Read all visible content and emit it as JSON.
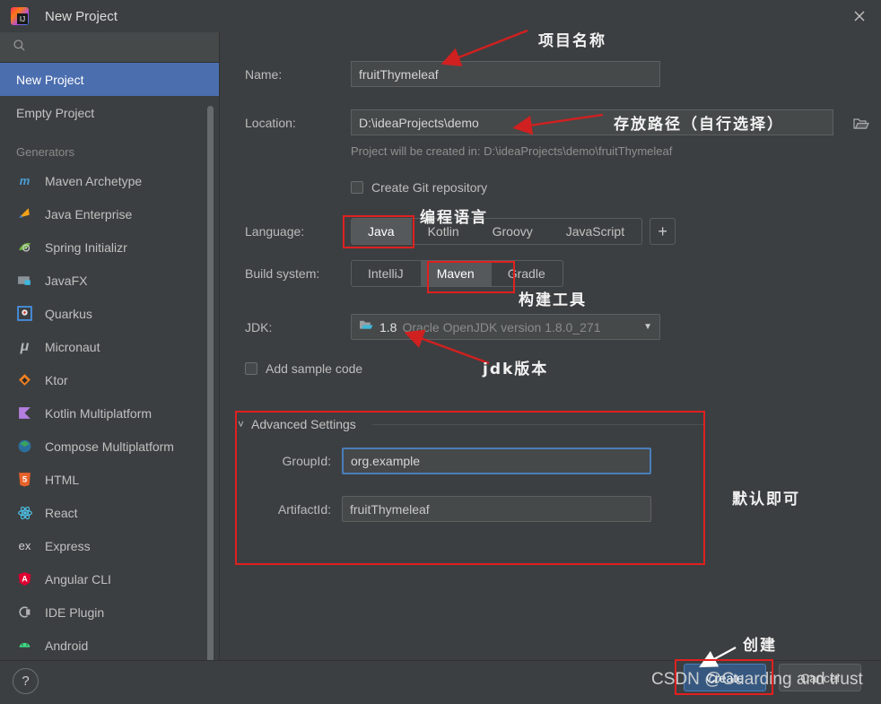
{
  "window": {
    "title": "New Project",
    "app_icon": "intellij-idea-icon",
    "close_icon": "close-icon"
  },
  "sidebar": {
    "search": {
      "icon": "search-icon",
      "placeholder": "",
      "value": ""
    },
    "projects": [
      {
        "label": "New Project",
        "selected": true
      },
      {
        "label": "Empty Project",
        "selected": false
      }
    ],
    "generators_label": "Generators",
    "generators": [
      {
        "label": "Maven Archetype",
        "icon": "maven-icon",
        "glyph": "m",
        "color": "#4a9ed8"
      },
      {
        "label": "Java Enterprise",
        "icon": "java-enterprise-icon",
        "glyph": "◢",
        "color": "#f4a11a"
      },
      {
        "label": "Spring Initializr",
        "icon": "spring-icon",
        "glyph": "◔",
        "color": "#6db33f"
      },
      {
        "label": "JavaFX",
        "icon": "javafx-icon",
        "glyph": "▬",
        "color": "#8b9499"
      },
      {
        "label": "Quarkus",
        "icon": "quarkus-icon",
        "glyph": "❖",
        "color": "#4695eb"
      },
      {
        "label": "Micronaut",
        "icon": "micronaut-icon",
        "glyph": "μ",
        "color": "#b4b7b9"
      },
      {
        "label": "Ktor",
        "icon": "ktor-icon",
        "glyph": "◆",
        "color": "#f4811f"
      },
      {
        "label": "Kotlin Multiplatform",
        "icon": "kotlin-icon",
        "glyph": "◥",
        "color": "#a97bd6"
      },
      {
        "label": "Compose Multiplatform",
        "icon": "compose-icon",
        "glyph": "⬢",
        "color": "#3ba45a"
      },
      {
        "label": "HTML",
        "icon": "html5-icon",
        "glyph": "5",
        "color": "#e8622a"
      },
      {
        "label": "React",
        "icon": "react-icon",
        "glyph": "⚛",
        "color": "#4dc0e6"
      },
      {
        "label": "Express",
        "icon": "express-icon",
        "glyph": "ex",
        "color": "#cfcfcf"
      },
      {
        "label": "Angular CLI",
        "icon": "angular-icon",
        "glyph": "A",
        "color": "#dd0031"
      },
      {
        "label": "IDE Plugin",
        "icon": "ide-plugin-icon",
        "glyph": "⚯",
        "color": "#b0b3b5"
      },
      {
        "label": "Android",
        "icon": "android-icon",
        "glyph": "◠",
        "color": "#3ddc84"
      }
    ],
    "scrollbar": "sidebar-scrollbar"
  },
  "form": {
    "name": {
      "label": "Name:",
      "value": "fruitThymeleaf"
    },
    "location": {
      "label": "Location:",
      "value": "D:\\ideaProjects\\demo",
      "browse_icon": "folder-browse-icon"
    },
    "location_hint": "Project will be created in: D:\\ideaProjects\\demo\\fruitThymeleaf",
    "git": {
      "label": "Create Git repository",
      "checked": false
    },
    "language": {
      "label": "Language:",
      "options": [
        "Java",
        "Kotlin",
        "Groovy",
        "JavaScript"
      ],
      "selected": "Java",
      "add_label": "+"
    },
    "build_system": {
      "label": "Build system:",
      "options": [
        "IntelliJ",
        "Maven",
        "Gradle"
      ],
      "selected": "Maven"
    },
    "jdk": {
      "label": "JDK:",
      "icon": "jdk-folder-icon",
      "version": "1.8",
      "description": "Oracle OpenJDK version 1.8.0_271",
      "caret_icon": "chevron-down-icon"
    },
    "sample_code": {
      "label": "Add sample code",
      "checked": false
    },
    "advanced": {
      "title": "Advanced Settings",
      "chevron_icon": "chevron-down-icon",
      "expanded": true,
      "group_id": {
        "label": "GroupId:",
        "value": "org.example"
      },
      "artifact_id": {
        "label": "ArtifactId:",
        "value": "fruitThymeleaf"
      }
    }
  },
  "footer": {
    "help_label": "?",
    "create_label": "Create",
    "cancel_label": "Cancel"
  },
  "watermark": "CSDN @Guarding and trust",
  "annotations": {
    "project_name": "项目名称",
    "storage_path": "存放路径（自行选择）",
    "programming_language": "编程语言",
    "build_tool": "构建工具",
    "jdk_version": "jdk版本",
    "defaults_ok": "默认即可",
    "create": "创建",
    "highlight_color": "#e02020",
    "arrow_color_red": "#d02020",
    "arrow_color_white": "#ffffff"
  }
}
